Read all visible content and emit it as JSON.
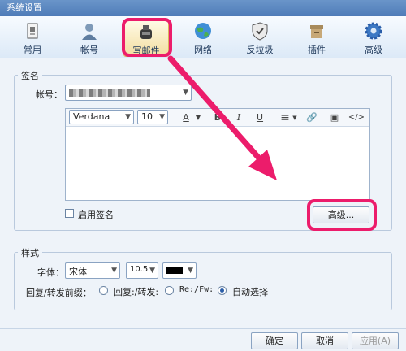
{
  "window": {
    "title": "系统设置"
  },
  "tabs": [
    {
      "label": "常用",
      "icon": "document-icon"
    },
    {
      "label": "帐号",
      "icon": "user-icon"
    },
    {
      "label": "写邮件",
      "icon": "ink-bottle-icon",
      "selected": true
    },
    {
      "label": "网络",
      "icon": "globe-icon"
    },
    {
      "label": "反垃圾",
      "icon": "shield-icon"
    },
    {
      "label": "插件",
      "icon": "box-icon"
    },
    {
      "label": "高级",
      "icon": "gear-icon"
    }
  ],
  "signature": {
    "group_label": "签名",
    "account_label": "帐号：",
    "font_name": "Verdana",
    "font_size": "10",
    "toolbar": {
      "color": "A",
      "bold": "B",
      "italic": "I",
      "underline": "U",
      "align": "≡",
      "link": "🔗",
      "image": "▣",
      "source": "</>"
    },
    "enable_label": "启用签名",
    "advanced_button": "高级..."
  },
  "style": {
    "group_label": "样式",
    "font_label": "字体：",
    "font_value": "宋体",
    "size_value": "10.5",
    "color_value": "#000000",
    "reply_label": "回复/转发前缀：",
    "options": [
      "回复:/转发:",
      "Re:/Fw:",
      "自动选择"
    ],
    "selected_option": 2
  },
  "footer": {
    "ok": "确定",
    "cancel": "取消",
    "apply": "应用(A)"
  },
  "accent": "#ec1c6b"
}
